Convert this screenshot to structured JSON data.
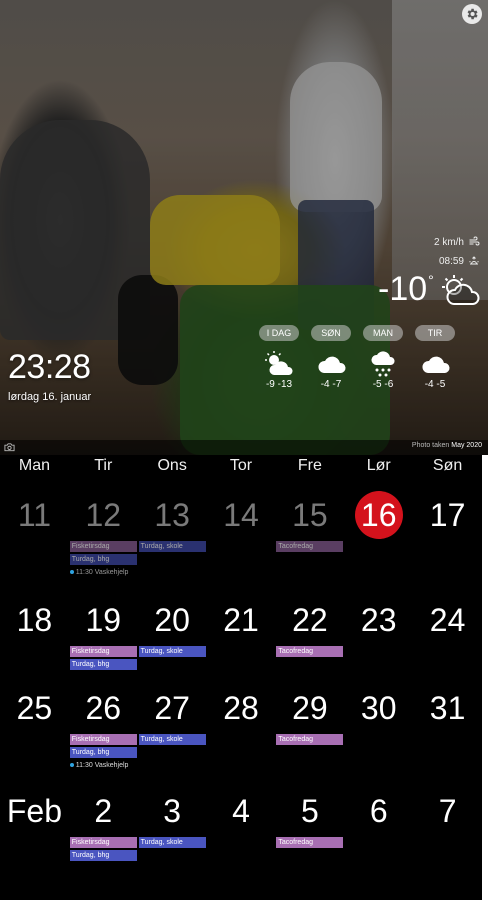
{
  "header": {
    "time": "23:28",
    "date": "lørdag 16. januar",
    "wind": "2 km/h",
    "sunrise": "08:59",
    "temp_now": "-10",
    "temp_unit": "°",
    "now_icon": "partly-cloudy-icon",
    "forecast": [
      {
        "label": "I DAG",
        "icon": "sun-cloud-icon",
        "temps": "-9   -13"
      },
      {
        "label": "SØN",
        "icon": "cloud-icon",
        "temps": "-4   -7"
      },
      {
        "label": "MAN",
        "icon": "snow-cloud-icon",
        "temps": "-5   -6"
      },
      {
        "label": "TIR",
        "icon": "cloud-icon",
        "temps": "-4   -5"
      }
    ],
    "photo_taken_label": "Photo taken",
    "photo_taken_date": "May 2020"
  },
  "calendar": {
    "weekdays": [
      "Man",
      "Tir",
      "Ons",
      "Tor",
      "Fre",
      "Lør",
      "Søn"
    ],
    "weeks": [
      {
        "days": [
          {
            "num": "11",
            "state": "past",
            "events": []
          },
          {
            "num": "12",
            "state": "past",
            "events": [
              {
                "type": "bar",
                "color": "purple",
                "text": "Fisketirsdag"
              },
              {
                "type": "bar",
                "color": "blue",
                "text": "Turdag, bhg"
              },
              {
                "type": "timed",
                "text": "11:30 Vaskehjelp"
              }
            ]
          },
          {
            "num": "13",
            "state": "past",
            "events": [
              {
                "type": "bar",
                "color": "blue",
                "text": "Turdag, skole"
              }
            ]
          },
          {
            "num": "14",
            "state": "past",
            "events": []
          },
          {
            "num": "15",
            "state": "past",
            "events": [
              {
                "type": "bar",
                "color": "purple",
                "text": "Tacofredag"
              }
            ]
          },
          {
            "num": "16",
            "state": "today",
            "events": []
          },
          {
            "num": "17",
            "state": "future",
            "events": []
          }
        ]
      },
      {
        "days": [
          {
            "num": "18",
            "state": "future",
            "events": []
          },
          {
            "num": "19",
            "state": "future",
            "events": [
              {
                "type": "bar",
                "color": "purple",
                "text": "Fisketirsdag"
              },
              {
                "type": "bar",
                "color": "blue",
                "text": "Turdag, bhg"
              }
            ]
          },
          {
            "num": "20",
            "state": "future",
            "events": [
              {
                "type": "bar",
                "color": "blue",
                "text": "Turdag, skole"
              }
            ]
          },
          {
            "num": "21",
            "state": "future",
            "events": []
          },
          {
            "num": "22",
            "state": "future",
            "events": [
              {
                "type": "bar",
                "color": "purple",
                "text": "Tacofredag"
              }
            ]
          },
          {
            "num": "23",
            "state": "future",
            "events": []
          },
          {
            "num": "24",
            "state": "future",
            "events": []
          }
        ]
      },
      {
        "days": [
          {
            "num": "25",
            "state": "future",
            "events": []
          },
          {
            "num": "26",
            "state": "future",
            "events": [
              {
                "type": "bar",
                "color": "purple",
                "text": "Fisketirsdag"
              },
              {
                "type": "bar",
                "color": "blue",
                "text": "Turdag, bhg"
              },
              {
                "type": "timed",
                "text": "11:30 Vaskehjelp"
              }
            ]
          },
          {
            "num": "27",
            "state": "future",
            "events": [
              {
                "type": "bar",
                "color": "blue",
                "text": "Turdag, skole"
              }
            ]
          },
          {
            "num": "28",
            "state": "future",
            "events": []
          },
          {
            "num": "29",
            "state": "future",
            "events": [
              {
                "type": "bar",
                "color": "purple",
                "text": "Tacofredag"
              }
            ]
          },
          {
            "num": "30",
            "state": "future",
            "events": []
          },
          {
            "num": "31",
            "state": "future",
            "events": []
          }
        ]
      },
      {
        "days": [
          {
            "num": "Feb",
            "state": "future",
            "events": []
          },
          {
            "num": "2",
            "state": "future",
            "events": [
              {
                "type": "bar",
                "color": "purple",
                "text": "Fisketirsdag"
              },
              {
                "type": "bar",
                "color": "blue",
                "text": "Turdag, bhg"
              }
            ]
          },
          {
            "num": "3",
            "state": "future",
            "events": [
              {
                "type": "bar",
                "color": "blue",
                "text": "Turdag, skole"
              }
            ]
          },
          {
            "num": "4",
            "state": "future",
            "events": []
          },
          {
            "num": "5",
            "state": "future",
            "events": [
              {
                "type": "bar",
                "color": "purple",
                "text": "Tacofredag"
              }
            ]
          },
          {
            "num": "6",
            "state": "future",
            "events": []
          },
          {
            "num": "7",
            "state": "future",
            "events": []
          }
        ]
      }
    ]
  },
  "colors": {
    "today": "#d4121c",
    "event_purple": "#a86fb3",
    "event_blue": "#4a55c0",
    "timed_dot": "#2fa3e0"
  }
}
